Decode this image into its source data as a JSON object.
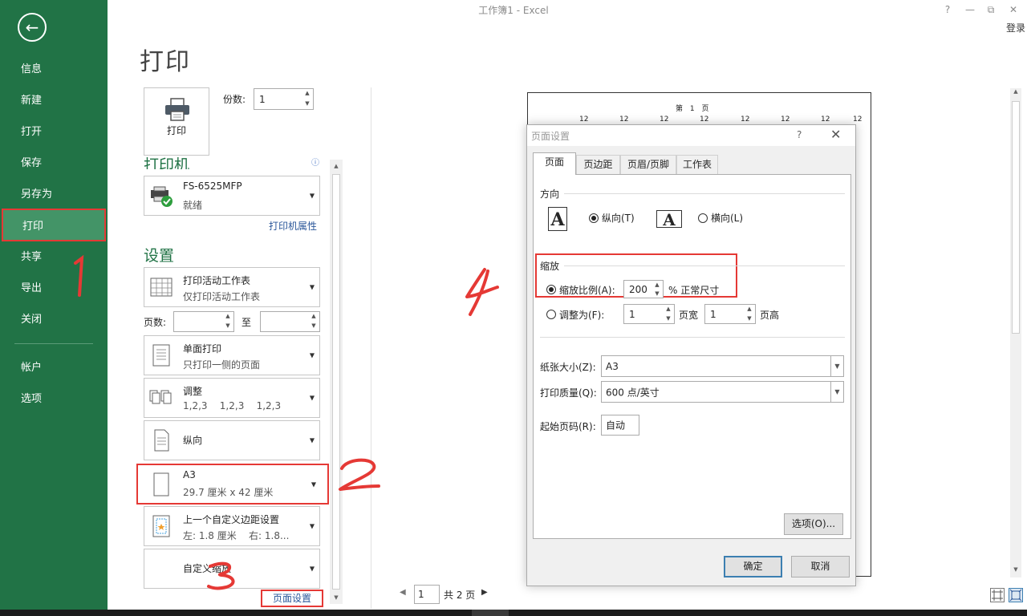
{
  "window": {
    "title": "工作簿1 - Excel",
    "help": "?",
    "minimize": "—",
    "restore": "⧉",
    "close": "✕",
    "login": "登录"
  },
  "sidebar": {
    "back": "←",
    "items": [
      {
        "label": "信息"
      },
      {
        "label": "新建"
      },
      {
        "label": "打开"
      },
      {
        "label": "保存"
      },
      {
        "label": "另存为"
      },
      {
        "label": "打印"
      },
      {
        "label": "共享"
      },
      {
        "label": "导出"
      },
      {
        "label": "关闭"
      },
      {
        "label": "帐户"
      },
      {
        "label": "选项"
      }
    ],
    "active": "打印"
  },
  "print": {
    "heading": "打印",
    "print_button": "打印",
    "copies_label": "份数:",
    "copies_value": "1",
    "printer_heading": "打印机",
    "printer_info_icon": "ⓘ",
    "printer_name": "FS-6525MFP",
    "printer_status": "就绪",
    "printer_properties": "打印机属性",
    "settings_heading": "设置",
    "scope_l1": "打印活动工作表",
    "scope_l2": "仅打印活动工作表",
    "pages_label": "页数:",
    "to_label": "至",
    "pages_from": "",
    "pages_to": "",
    "sides_l1": "单面打印",
    "sides_l2": "只打印一侧的页面",
    "collate_l1": "调整",
    "collate_l2": "1,2,3    1,2,3    1,2,3",
    "orientation_l1": "纵向",
    "paper_l1": "A3",
    "paper_l2": "29.7 厘米 x 42 厘米",
    "margins_l1": "上一个自定义边距设置",
    "margins_l2": "左: 1.8 厘米    右: 1.8...",
    "scaling_l1": "自定义缩放",
    "page_setup_link": "页面设置"
  },
  "annotations": {
    "a1": "1",
    "a2": "2",
    "a3": "3",
    "a4": "4"
  },
  "preview": {
    "page_label": "第 1 页",
    "cells": [
      "12",
      "12",
      "12",
      "12",
      "12",
      "12",
      "12",
      "12"
    ],
    "current_page": "1",
    "total_pages": "共 2 页",
    "prev": "◀",
    "next": "▶"
  },
  "dialog": {
    "title": "页面设置",
    "help": "?",
    "close": "✕",
    "tabs": [
      {
        "label": "页面"
      },
      {
        "label": "页边距"
      },
      {
        "label": "页眉/页脚"
      },
      {
        "label": "工作表"
      }
    ],
    "orientation_title": "方向",
    "portrait_label": "纵向(T)",
    "landscape_label": "横向(L)",
    "orient_glyph": "A",
    "scaling_title": "缩放",
    "adjust_label": "缩放比例(A):",
    "adjust_value": "200",
    "adjust_suffix": "% 正常尺寸",
    "fit_label": "调整为(F):",
    "fit_wide_value": "1",
    "fit_wide_suffix": "页宽",
    "fit_tall_value": "1",
    "fit_tall_suffix": "页高",
    "paper_size_label": "纸张大小(Z):",
    "paper_size_value": "A3",
    "quality_label": "打印质量(Q):",
    "quality_value": "600 点/英寸",
    "first_page_label": "起始页码(R):",
    "first_page_value": "自动",
    "options_button": "选项(O)...",
    "ok_button": "确定",
    "cancel_button": "取消"
  },
  "colors": {
    "excel_green": "#217346",
    "sidebar_active": "#439467",
    "annotation_red": "#e53935",
    "link_blue": "#2b579a"
  }
}
